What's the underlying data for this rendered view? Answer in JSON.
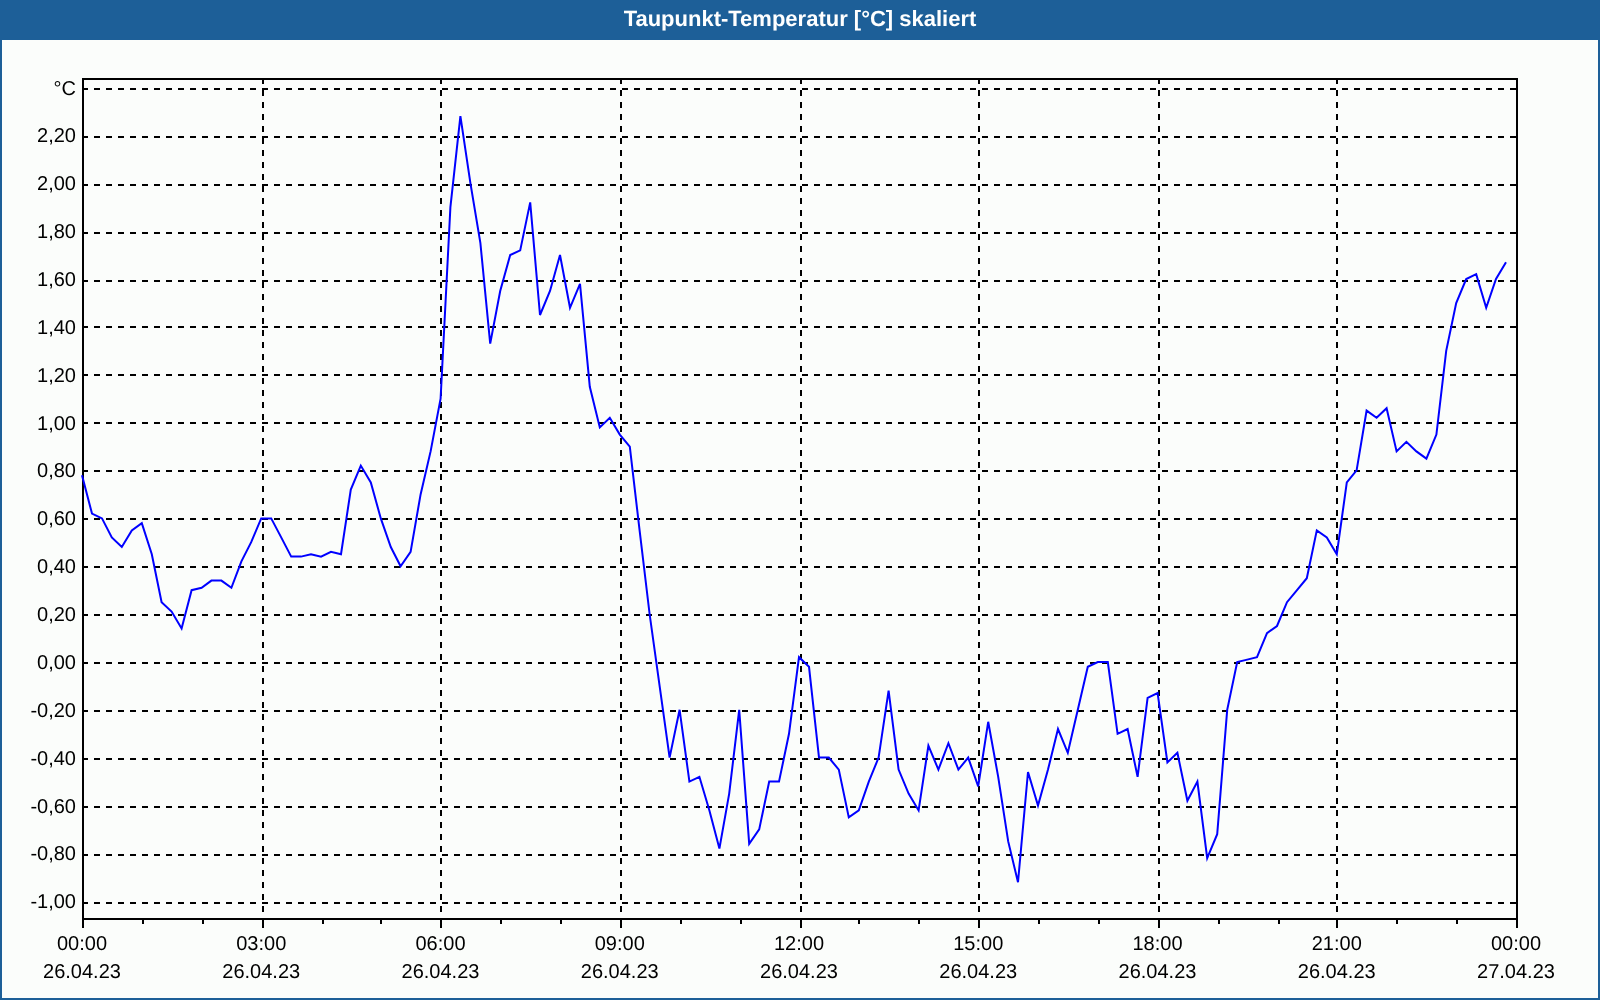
{
  "window": {
    "title": "Taupunkt-Temperatur [°C] skaliert"
  },
  "chart": {
    "time_labels": [
      "00:00",
      "03:00",
      "06:00",
      "09:00",
      "12:00",
      "15:00",
      "18:00",
      "21:00",
      "00:00"
    ],
    "date_labels": [
      "26.04.23",
      "26.04.23",
      "26.04.23",
      "26.04.23",
      "26.04.23",
      "26.04.23",
      "26.04.23",
      "26.04.23",
      "27.04.23"
    ],
    "chart_data": {
      "type": "line",
      "grid": true,
      "ylim": [
        -1.07,
        2.44
      ],
      "yticks": [
        {
          "value": -1,
          "label": "-1,00"
        },
        {
          "value": -0.8,
          "label": "-0,80"
        },
        {
          "value": -0.6,
          "label": "-0,60"
        },
        {
          "value": -0.4,
          "label": "-0,40"
        },
        {
          "value": -0.2,
          "label": "-0,20"
        },
        {
          "value": 0,
          "label": "0,00"
        },
        {
          "value": 0.2,
          "label": "0,20"
        },
        {
          "value": 0.4,
          "label": "0,40"
        },
        {
          "value": 0.6,
          "label": "0,60"
        },
        {
          "value": 0.8,
          "label": "0,80"
        },
        {
          "value": 1,
          "label": "1,00"
        },
        {
          "value": 1.2,
          "label": "1,20"
        },
        {
          "value": 1.4,
          "label": "1,40"
        },
        {
          "value": 1.6,
          "label": "1,60"
        },
        {
          "value": 1.8,
          "label": "1,80"
        },
        {
          "value": 2,
          "label": "2,00"
        },
        {
          "value": 2.2,
          "label": "2,20"
        },
        {
          "value": 2.4,
          "label": "°C"
        }
      ],
      "series": [
        {
          "color": "#0000ff",
          "values": [
            0.78,
            0.62,
            0.6,
            0.52,
            0.48,
            0.55,
            0.58,
            0.45,
            0.25,
            0.21,
            0.14,
            0.3,
            0.31,
            0.34,
            0.34,
            0.31,
            0.42,
            0.5,
            0.6,
            0.6,
            0.52,
            0.44,
            0.44,
            0.45,
            0.44,
            0.46,
            0.45,
            0.72,
            0.82,
            0.75,
            0.6,
            0.48,
            0.4,
            0.46,
            0.7,
            0.88,
            1.1,
            1.9,
            2.28,
            2.0,
            1.75,
            1.33,
            1.55,
            1.7,
            1.72,
            1.92,
            1.45,
            1.55,
            1.7,
            1.48,
            1.58,
            1.15,
            0.98,
            1.02,
            0.95,
            0.9,
            0.55,
            0.2,
            -0.1,
            -0.4,
            -0.2,
            -0.5,
            -0.48,
            -0.62,
            -0.78,
            -0.55,
            -0.2,
            -0.76,
            -0.7,
            -0.5,
            -0.5,
            -0.3,
            0.02,
            -0.02,
            -0.4,
            -0.4,
            -0.45,
            -0.65,
            -0.62,
            -0.5,
            -0.4,
            -0.12,
            -0.45,
            -0.55,
            -0.62,
            -0.35,
            -0.45,
            -0.34,
            -0.45,
            -0.4,
            -0.52,
            -0.25,
            -0.48,
            -0.75,
            -0.92,
            -0.46,
            -0.6,
            -0.45,
            -0.28,
            -0.38,
            -0.2,
            -0.02,
            0.0,
            0.0,
            -0.3,
            -0.28,
            -0.48,
            -0.15,
            -0.13,
            -0.42,
            -0.38,
            -0.58,
            -0.5,
            -0.82,
            -0.72,
            -0.2,
            0.0,
            0.01,
            0.02,
            0.12,
            0.15,
            0.25,
            0.3,
            0.35,
            0.55,
            0.52,
            0.45,
            0.75,
            0.8,
            1.05,
            1.02,
            1.06,
            0.88,
            0.92,
            0.88,
            0.85,
            0.95,
            1.3,
            1.5,
            1.6,
            1.62,
            1.48,
            1.6,
            1.67
          ]
        }
      ]
    }
  }
}
